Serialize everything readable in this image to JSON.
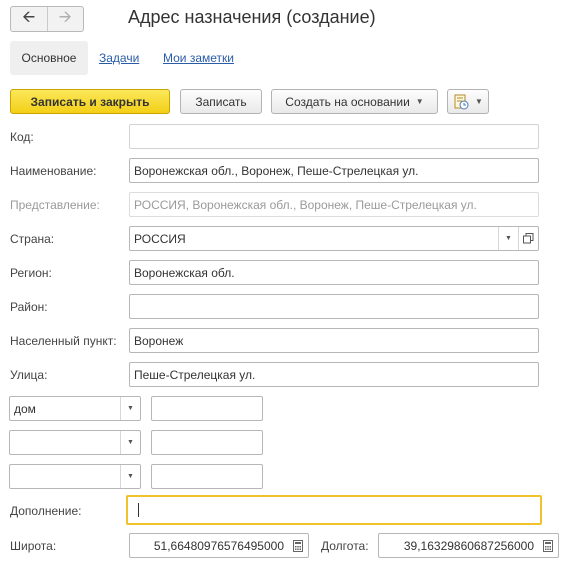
{
  "nav": {
    "back_icon": "arrow-left-icon",
    "forward_icon": "arrow-right-icon"
  },
  "window": {
    "title": "Адрес назначения (создание)"
  },
  "tabs": [
    {
      "label": "Основное",
      "active": true
    },
    {
      "label": "Задачи",
      "active": false
    },
    {
      "label": "Мои заметки",
      "active": false
    }
  ],
  "toolbar": {
    "save_close": "Записать и закрыть",
    "save": "Записать",
    "create_based": "Создать на основании",
    "more_icon": "document-clock-icon"
  },
  "form": {
    "code": {
      "label": "Код:",
      "value": ""
    },
    "name": {
      "label": "Наименование:",
      "value": "Воронежская обл., Воронеж, Пеше-Стрелецкая ул."
    },
    "presentation": {
      "label": "Представление:",
      "value": "РОССИЯ, Воронежская обл., Воронеж, Пеше-Стрелецкая ул."
    },
    "country": {
      "label": "Страна:",
      "value": "РОССИЯ"
    },
    "region": {
      "label": "Регион:",
      "value": "Воронежская обл."
    },
    "district": {
      "label": "Район:",
      "value": ""
    },
    "locality": {
      "label": "Населенный пункт:",
      "value": "Воронеж"
    },
    "street": {
      "label": "Улица:",
      "value": "Пеше-Стрелецкая ул."
    },
    "building_rows": [
      {
        "type": "дом",
        "number": ""
      },
      {
        "type": "",
        "number": ""
      },
      {
        "type": "",
        "number": ""
      }
    ],
    "addition": {
      "label": "Дополнение:",
      "value": ""
    },
    "latitude": {
      "label": "Широта:",
      "value": "51,66480976576495000"
    },
    "longitude": {
      "label": "Долгота:",
      "value": "39,16329860687256000"
    }
  },
  "colors": {
    "accent": "#f3cf17",
    "link": "#2a5da8",
    "focus": "#f0c22b"
  }
}
